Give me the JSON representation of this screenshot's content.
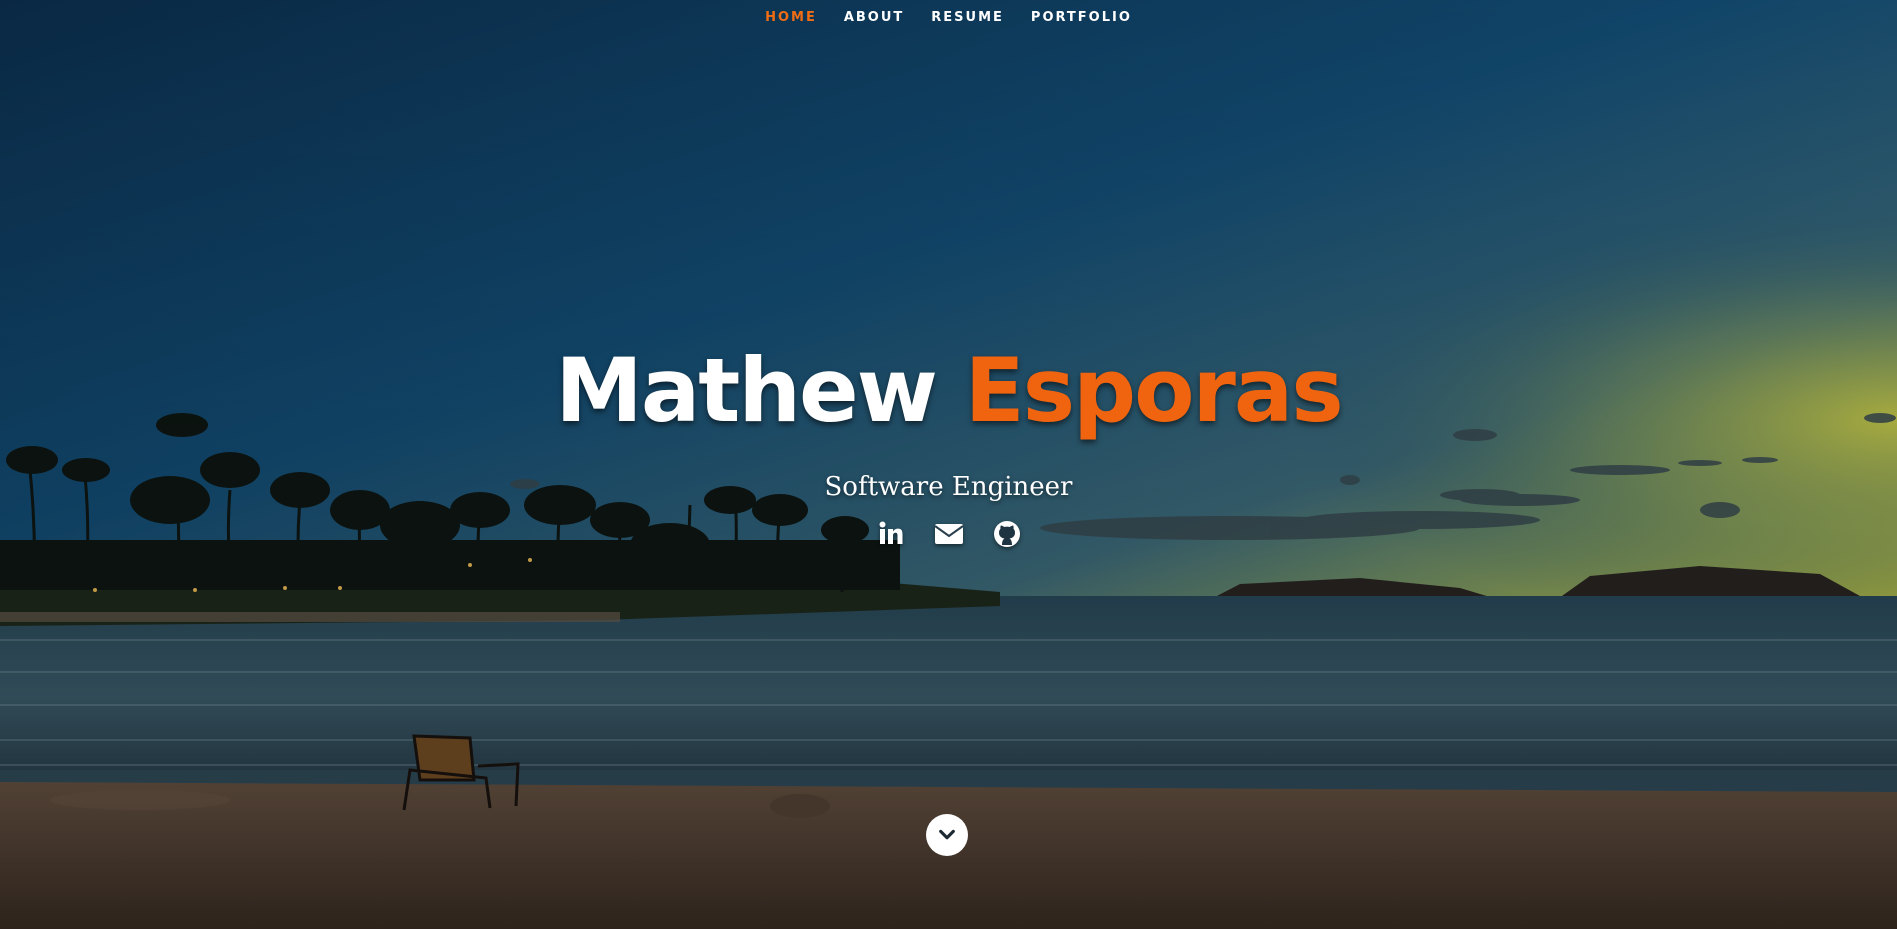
{
  "nav": {
    "items": [
      {
        "label": "HOME",
        "active": true
      },
      {
        "label": "ABOUT",
        "active": false
      },
      {
        "label": "RESUME",
        "active": false
      },
      {
        "label": "PORTFOLIO",
        "active": false
      }
    ]
  },
  "hero": {
    "first_name": "Mathew",
    "last_name": "Esporas",
    "subtitle": "Software Engineer",
    "social_icons": [
      "linkedin-icon",
      "envelope-icon",
      "github-icon"
    ],
    "scroll_icon": "chevron-down-icon"
  },
  "colors": {
    "accent": "#f0640f",
    "text": "#ffffff",
    "sky_top": "#0c3456",
    "sky_horizon": "#c9d44c",
    "sand": "#5a4838"
  }
}
